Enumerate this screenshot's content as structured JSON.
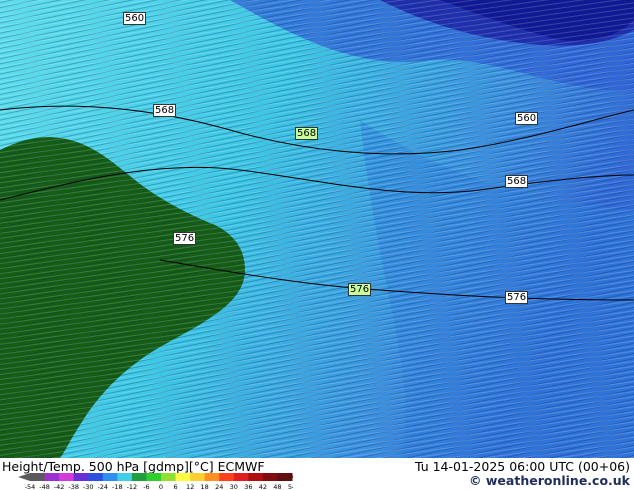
{
  "map": {
    "contour_labels": [
      {
        "text": "560",
        "highlight": false
      },
      {
        "text": "568",
        "highlight": false
      },
      {
        "text": "568",
        "highlight": true
      },
      {
        "text": "560",
        "highlight": false
      },
      {
        "text": "568",
        "highlight": false
      },
      {
        "text": "576",
        "highlight": false
      },
      {
        "text": "576",
        "highlight": true
      },
      {
        "text": "576",
        "highlight": false
      }
    ],
    "colors": {
      "deep_blue": "#0f1896",
      "blue": "#2f5fd6",
      "cyan": "#3fd0e8",
      "light_cyan": "#6fe8f2",
      "land_green": "#145e14"
    }
  },
  "footer": {
    "title": "Height/Temp. 500 hPa [gdmp][°C] ECMWF",
    "datetime": "Tu 14-01-2025 06:00 UTC (00+06)",
    "credit": "© weatheronline.co.uk",
    "scale_values": [
      "-54",
      "-48",
      "-42",
      "-38",
      "-30",
      "-24",
      "-18",
      "-12",
      "-6",
      "0",
      "6",
      "12",
      "18",
      "24",
      "30",
      "36",
      "42",
      "48",
      "54"
    ],
    "scale_colors": [
      "#5a5a5a",
      "#9b2fcf",
      "#d23dd8",
      "#6a2fd6",
      "#2f4fe0",
      "#2f8ff0",
      "#3fd0e8",
      "#1f9f3f",
      "#2fcf2f",
      "#8fe02f",
      "#ffff3f",
      "#ffcf2f",
      "#ff8f1f",
      "#ff3f1f",
      "#df1f1f",
      "#af0f0f",
      "#7f0f0f",
      "#5f0f0f"
    ]
  }
}
